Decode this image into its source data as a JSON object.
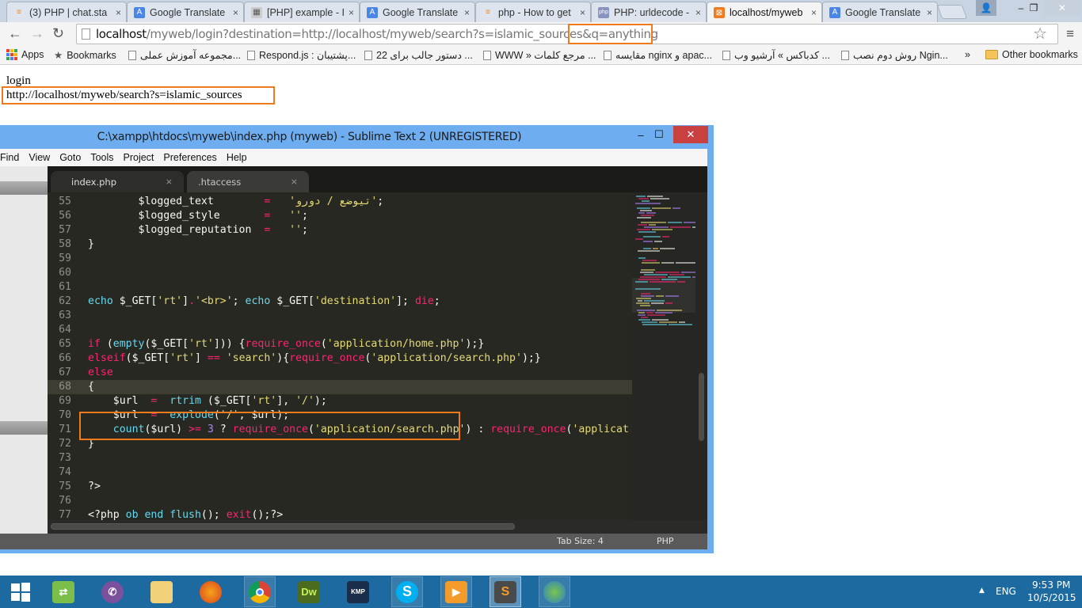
{
  "browser": {
    "tabs": [
      {
        "title": "(3) PHP | chat.sta",
        "icon": "stackoverflow-icon",
        "active": false
      },
      {
        "title": "Google Translate",
        "icon": "google-translate-icon",
        "active": false
      },
      {
        "title": "[PHP] example - I",
        "icon": "forum-icon",
        "active": false
      },
      {
        "title": "Google Translate",
        "icon": "google-translate-icon",
        "active": false
      },
      {
        "title": "php - How to get",
        "icon": "stackoverflow-icon",
        "active": false
      },
      {
        "title": "PHP: urldecode -",
        "icon": "php-icon",
        "active": false
      },
      {
        "title": "localhost/myweb",
        "icon": "xampp-icon",
        "active": true
      },
      {
        "title": "Google Translate",
        "icon": "google-translate-icon",
        "active": false
      }
    ],
    "close_glyph": "×",
    "address": {
      "host": "localhost",
      "path": "/myweb/login?destination=http://localhost/myweb/search?s=islamic_sources&q=anything"
    },
    "bookmarks": {
      "apps": "Apps",
      "bookmarks": "Bookmarks",
      "items": [
        "مجموعه آموزش عملی...",
        "Respond.js : پشتیبان...",
        "22 دستور جالب برای ...",
        "WWW » مرجع کلمات ...",
        "مقایسه nginx و apac...",
        "کدباکس » آرشیو وب ...",
        "روش دوم نصب Ngin..."
      ],
      "overflow": "»",
      "other": "Other bookmarks"
    }
  },
  "page": {
    "line1": "login",
    "line2": "http://localhost/myweb/search?s=islamic_sources"
  },
  "sublime": {
    "title": "C:\\xampp\\htdocs\\myweb\\index.php (myweb) - Sublime Text 2 (UNREGISTERED)",
    "menu": [
      "Find",
      "View",
      "Goto",
      "Tools",
      "Project",
      "Preferences",
      "Help"
    ],
    "tabs": [
      {
        "label": "index.php",
        "active": true
      },
      {
        "label": ".htaccess",
        "active": false
      }
    ],
    "tab_close": "×",
    "current_line": 68,
    "lines": [
      {
        "n": 55,
        "tokens": [
          [
            "",
            "        $logged_text        "
          ],
          [
            "kw",
            "="
          ],
          [
            "",
            "   "
          ],
          [
            "st",
            "'تیوضع / دورو'"
          ],
          [
            "",
            ";"
          ]
        ]
      },
      {
        "n": 56,
        "tokens": [
          [
            "",
            "        $logged_style       "
          ],
          [
            "kw",
            "="
          ],
          [
            "",
            "   "
          ],
          [
            "st",
            "''"
          ],
          [
            "",
            ";"
          ]
        ]
      },
      {
        "n": 57,
        "tokens": [
          [
            "",
            "        $logged_reputation  "
          ],
          [
            "kw",
            "="
          ],
          [
            "",
            "   "
          ],
          [
            "st",
            "''"
          ],
          [
            "",
            ";"
          ]
        ]
      },
      {
        "n": 58,
        "tokens": [
          [
            "",
            "}"
          ]
        ]
      },
      {
        "n": 59,
        "tokens": []
      },
      {
        "n": 60,
        "tokens": []
      },
      {
        "n": 61,
        "tokens": []
      },
      {
        "n": 62,
        "tokens": [
          [
            "fn",
            "echo"
          ],
          [
            "",
            " $_GET["
          ],
          [
            "st",
            "'rt'"
          ],
          [
            "",
            "]"
          ],
          [
            "kw",
            "."
          ],
          [
            "st",
            "'<br>'"
          ],
          [
            "",
            "; "
          ],
          [
            "fn",
            "echo"
          ],
          [
            "",
            " $_GET["
          ],
          [
            "st",
            "'destination'"
          ],
          [
            "",
            "]; "
          ],
          [
            "kw",
            "die"
          ],
          [
            "",
            ";"
          ]
        ]
      },
      {
        "n": 63,
        "tokens": []
      },
      {
        "n": 64,
        "tokens": []
      },
      {
        "n": 65,
        "tokens": [
          [
            "kw",
            "if"
          ],
          [
            "",
            " ("
          ],
          [
            "fn",
            "empty"
          ],
          [
            "",
            "($_GET["
          ],
          [
            "st",
            "'rt'"
          ],
          [
            "",
            "])) {"
          ],
          [
            "kw",
            "require_once"
          ],
          [
            "",
            "("
          ],
          [
            "st",
            "'application/home.php'"
          ],
          [
            "",
            ");}"
          ]
        ]
      },
      {
        "n": 66,
        "tokens": [
          [
            "kw",
            "elseif"
          ],
          [
            "",
            "($_GET["
          ],
          [
            "st",
            "'rt'"
          ],
          [
            "",
            "] "
          ],
          [
            "kw",
            "=="
          ],
          [
            "",
            " "
          ],
          [
            "st",
            "'search'"
          ],
          [
            "",
            "){"
          ],
          [
            "kw",
            "require_once"
          ],
          [
            "",
            "("
          ],
          [
            "st",
            "'application/search.php'"
          ],
          [
            "",
            ");}"
          ]
        ]
      },
      {
        "n": 67,
        "tokens": [
          [
            "kw",
            "else"
          ]
        ]
      },
      {
        "n": 68,
        "tokens": [
          [
            "",
            "{"
          ]
        ]
      },
      {
        "n": 69,
        "tokens": [
          [
            "",
            "    $url  "
          ],
          [
            "kw",
            "="
          ],
          [
            "",
            "  "
          ],
          [
            "fn",
            "rtrim"
          ],
          [
            "",
            " ($_GET["
          ],
          [
            "st",
            "'rt'"
          ],
          [
            "",
            "], "
          ],
          [
            "st",
            "'/'"
          ],
          [
            "",
            ");"
          ]
        ]
      },
      {
        "n": 70,
        "tokens": [
          [
            "",
            "    $url  "
          ],
          [
            "kw",
            "="
          ],
          [
            "",
            "  "
          ],
          [
            "fn",
            "explode"
          ],
          [
            "",
            "("
          ],
          [
            "st",
            "'/'"
          ],
          [
            "",
            ", $url);"
          ]
        ]
      },
      {
        "n": 71,
        "tokens": [
          [
            "",
            "    "
          ],
          [
            "fn",
            "count"
          ],
          [
            "",
            "($url) "
          ],
          [
            "kw",
            ">="
          ],
          [
            "",
            " "
          ],
          [
            "nm",
            "3"
          ],
          [
            "",
            " ? "
          ],
          [
            "kw",
            "require_once"
          ],
          [
            "",
            "("
          ],
          [
            "st",
            "'application/search.php'"
          ],
          [
            "",
            ") : "
          ],
          [
            "kw",
            "require_once"
          ],
          [
            "",
            "("
          ],
          [
            "st",
            "'applicat"
          ]
        ]
      },
      {
        "n": 72,
        "tokens": [
          [
            "",
            "}"
          ]
        ]
      },
      {
        "n": 73,
        "tokens": []
      },
      {
        "n": 74,
        "tokens": []
      },
      {
        "n": 75,
        "tokens": [
          [
            "",
            "?>"
          ]
        ]
      },
      {
        "n": 76,
        "tokens": []
      },
      {
        "n": 77,
        "tokens": [
          [
            "",
            "<?php "
          ],
          [
            "fn",
            "ob end flush"
          ],
          [
            "",
            "(); "
          ],
          [
            "kw",
            "exit"
          ],
          [
            "",
            "();?>"
          ]
        ]
      }
    ],
    "status": {
      "tab_size": "Tab Size: 4",
      "syntax": "PHP"
    }
  },
  "taskbar": {
    "apps": [
      {
        "name": "start",
        "label": ""
      },
      {
        "name": "network-drive",
        "label": ""
      },
      {
        "name": "viber",
        "label": ""
      },
      {
        "name": "file-explorer",
        "label": ""
      },
      {
        "name": "firefox",
        "label": ""
      },
      {
        "name": "chrome",
        "label": ""
      },
      {
        "name": "dreamweaver",
        "label": "Dw"
      },
      {
        "name": "kmplayer",
        "label": "KMP"
      },
      {
        "name": "skype",
        "label": "S"
      },
      {
        "name": "media-player",
        "label": ""
      },
      {
        "name": "sublime-text",
        "label": "S"
      },
      {
        "name": "internet-download-manager",
        "label": ""
      }
    ],
    "tray": {
      "chevron": "▲",
      "language": "ENG",
      "time": "9:53 PM",
      "date": "10/5/2015"
    }
  }
}
